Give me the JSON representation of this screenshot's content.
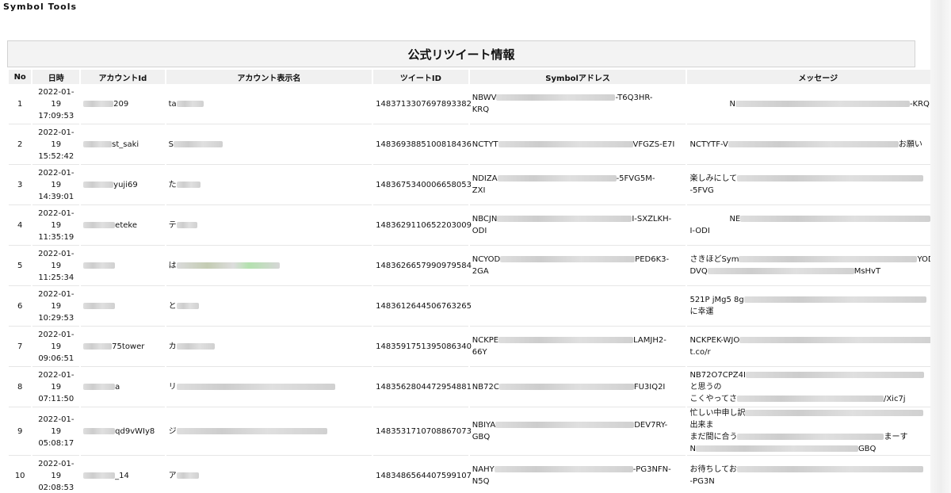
{
  "app": {
    "title": "Symbol Tools"
  },
  "panel": {
    "title": "公式リツイート情報"
  },
  "table": {
    "headers": [
      "No",
      "日時",
      "アカウントId",
      "アカウント表示名",
      "ツイートID",
      "Symbolアドレス",
      "メッセージ"
    ],
    "rows": [
      {
        "no": "1",
        "date": "2022-01-",
        "day": "19",
        "time": "17:09:53",
        "acc": "209",
        "name": "ta",
        "tweet": "1483713307697893382",
        "addr1a": "NBWV",
        "addr1b": "-T6Q3HR-",
        "addr2": "KRQ",
        "msg1a": "N",
        "msg1b": "-KRQ",
        "msg2": ""
      },
      {
        "no": "2",
        "date": "2022-01-",
        "day": "19",
        "time": "15:52:42",
        "acc": "st_saki",
        "name": "S",
        "tweet": "1483693885100818436",
        "addr1a": "NCTYT",
        "addr1b": "VFGZS-E7I",
        "addr2": "",
        "msg1a": "NCTYTF-V",
        "msg1b": "お願い",
        "msg2": ""
      },
      {
        "no": "3",
        "date": "2022-01-",
        "day": "19",
        "time": "14:39:01",
        "acc": "yuji69",
        "name": "た",
        "tweet": "1483675340006658053",
        "addr1a": "NDIZA",
        "addr1b": "-5FVG5M-",
        "addr2": "ZXI",
        "msg1a": "楽しみにして",
        "msg1b": "-5FVG",
        "msg2": ""
      },
      {
        "no": "4",
        "date": "2022-01-",
        "day": "19",
        "time": "11:35:19",
        "acc": "eteke",
        "name": "テ",
        "tweet": "1483629110652203009",
        "addr1a": "NBCJN",
        "addr1b": "I-SXZLKH-",
        "addr2": "ODI",
        "msg1a": "NE",
        "msg1b": "I-ODI",
        "msg2": ""
      },
      {
        "no": "5",
        "date": "2022-01-",
        "day": "19",
        "time": "11:25:34",
        "acc": "",
        "name": "は",
        "tweet": "1483626657990979584",
        "addr1a": "NCYOD",
        "addr1b": "PED6K3-",
        "addr2": "2GA",
        "msg1a": "さきほどSym",
        "msg1b": "YODG-",
        "msg2a": "DVQ",
        "msg2b": "MsHvT"
      },
      {
        "no": "6",
        "date": "2022-01-",
        "day": "19",
        "time": "10:29:53",
        "acc": "",
        "name": "と",
        "tweet": "1483612644506763265",
        "addr1a": "",
        "addr1b": "",
        "addr2": "",
        "msg1a": "521P jMg5 8g",
        "msg1b": "に幸運",
        "msg2": ""
      },
      {
        "no": "7",
        "date": "2022-01-",
        "day": "19",
        "time": "09:06:51",
        "acc": "75tower",
        "name": "カ",
        "tweet": "1483591751395086340",
        "addr1a": "NCKPE",
        "addr1b": "LAMJH2-",
        "addr2": "66Y",
        "msg1a": "NCKPEK-WJO",
        "msg1b": "t.co/r",
        "msg2": ""
      },
      {
        "no": "8",
        "date": "2022-01-",
        "day": "19",
        "time": "07:11:50",
        "acc": "a",
        "name": "リ",
        "tweet": "1483562804472954881",
        "addr1a": "NB72C",
        "addr1b": "FU3IQ2I",
        "addr2": "",
        "msg1a": "NB72O7CPZ4I",
        "msg1b": "と思うの",
        "msg2a": "こくやってさ",
        "msg2b": "/Xic7j"
      },
      {
        "no": "9",
        "date": "2022-01-",
        "day": "19",
        "time": "05:08:17",
        "acc": "qd9vWIy8",
        "name": "ジ",
        "tweet": "1483531710708867073",
        "addr1a": "NBIYA",
        "addr1b": "DEV7RY-",
        "addr2": "GBQ",
        "msg1a": "忙しい中申し訳",
        "msg1b": "出来ま",
        "msg2a": "まだ間に合う",
        "msg2b": "まーす",
        "msg3a": "N",
        "msg3b": "GBQ"
      },
      {
        "no": "10",
        "date": "2022-01-",
        "day": "19",
        "time": "02:08:53",
        "acc": "_14",
        "name": "ア",
        "tweet": "1483486564407599107",
        "addr1a": "NAHY",
        "addr1b": "-PG3NFN-",
        "addr2": "N5Q",
        "msg1a": "お待ちしてお",
        "msg1b": "-PG3N",
        "msg2": ""
      }
    ]
  }
}
